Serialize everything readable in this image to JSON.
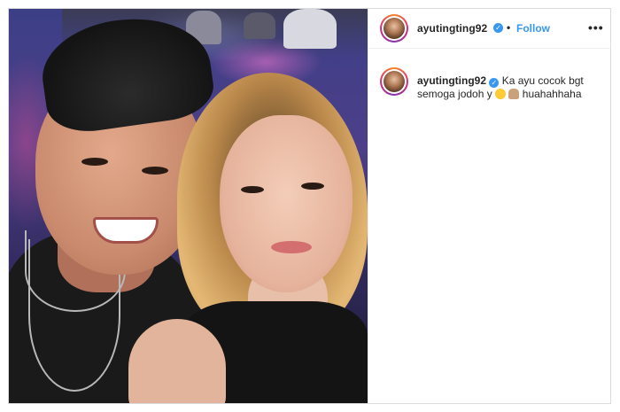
{
  "post": {
    "username": "ayutingting92",
    "follow_label": "Follow",
    "separator": "•",
    "more_label": "•••"
  },
  "caption": {
    "username": "ayutingting92",
    "text_before": "Ka ayu cocok bgt semoga jodoh y",
    "emojis": [
      "heart-eyes-emoji",
      "folded-hands-emoji"
    ],
    "text_after": "huahahhaha"
  },
  "colors": {
    "accent": "#3897f0",
    "border": "#dbdbdb",
    "text": "#262626"
  }
}
